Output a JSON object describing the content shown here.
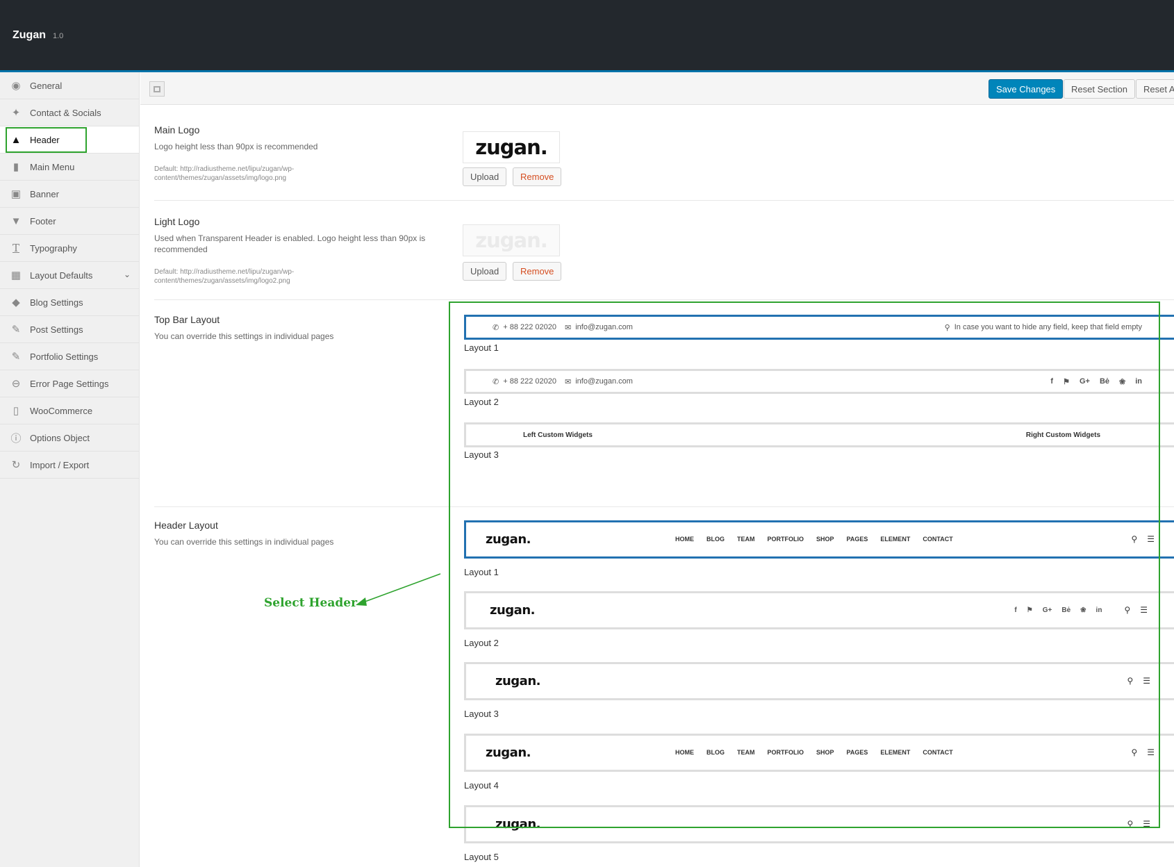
{
  "app": {
    "title": "Zugan",
    "version": "1.0"
  },
  "sidebar": {
    "items": [
      {
        "label": "General",
        "icon": "globe-icon"
      },
      {
        "label": "Contact & Socials",
        "icon": "twitter-icon"
      },
      {
        "label": "Header",
        "icon": "triangle-up-icon"
      },
      {
        "label": "Main Menu",
        "icon": "book-icon"
      },
      {
        "label": "Banner",
        "icon": "picture-icon"
      },
      {
        "label": "Footer",
        "icon": "triangle-down-icon"
      },
      {
        "label": "Typography",
        "icon": "text-icon"
      },
      {
        "label": "Layout Defaults",
        "icon": "grid-icon"
      },
      {
        "label": "Blog Settings",
        "icon": "tags-icon"
      },
      {
        "label": "Post Settings",
        "icon": "edit-icon"
      },
      {
        "label": "Portfolio Settings",
        "icon": "edit-icon"
      },
      {
        "label": "Error Page Settings",
        "icon": "minus-circle-icon"
      },
      {
        "label": "WooCommerce",
        "icon": "cart-icon"
      },
      {
        "label": "Options Object",
        "icon": "info-icon"
      },
      {
        "label": "Import / Export",
        "icon": "refresh-icon"
      }
    ],
    "active": "Header"
  },
  "toolbar": {
    "save": "Save Changes",
    "reset_section": "Reset Section",
    "reset_all": "Reset All"
  },
  "fields": {
    "main_logo": {
      "title": "Main Logo",
      "subtitle": "Logo height less than 90px is recommended",
      "default": "Default: http://radiustheme.net/lipu/zugan/wp-content/themes/zugan/assets/img/logo.png",
      "logo_text": "zugan.",
      "upload": "Upload",
      "remove": "Remove"
    },
    "light_logo": {
      "title": "Light Logo",
      "subtitle": "Used when Transparent Header is enabled. Logo height less than 90px is recommended",
      "default": "Default: http://radiustheme.net/lipu/zugan/wp-content/themes/zugan/assets/img/logo2.png",
      "logo_text": "zugan.",
      "upload": "Upload",
      "remove": "Remove"
    },
    "top_bar": {
      "title": "Top Bar Layout",
      "subtitle": "You can override this settings in individual pages",
      "phone": "+ 88 222 02020",
      "email": "info@zugan.com",
      "notice": "In case you want to hide any field, keep that field empty",
      "left_widgets": "Left Custom Widgets",
      "right_widgets": "Right Custom Widgets",
      "layouts": [
        "Layout 1",
        "Layout 2",
        "Layout 3"
      ]
    },
    "header_layout": {
      "title": "Header Layout",
      "subtitle": "You can override this settings in individual pages",
      "logo_text": "zugan.",
      "menu": [
        "HOME",
        "BLOG",
        "TEAM",
        "PORTFOLIO",
        "SHOP",
        "PAGES",
        "ELEMENT",
        "CONTACT"
      ],
      "social": [
        "f",
        "⚑",
        "G+",
        "Bė",
        "❀",
        "in"
      ],
      "layouts": [
        "Layout 1",
        "Layout 2",
        "Layout 3",
        "Layout 4",
        "Layout 5"
      ]
    }
  },
  "annotation": {
    "label": "Select Header",
    "color": "#2ea32e"
  },
  "colors": {
    "accent": "#0085ba",
    "selected_border": "#2271b1",
    "remove": "#d54e21"
  }
}
